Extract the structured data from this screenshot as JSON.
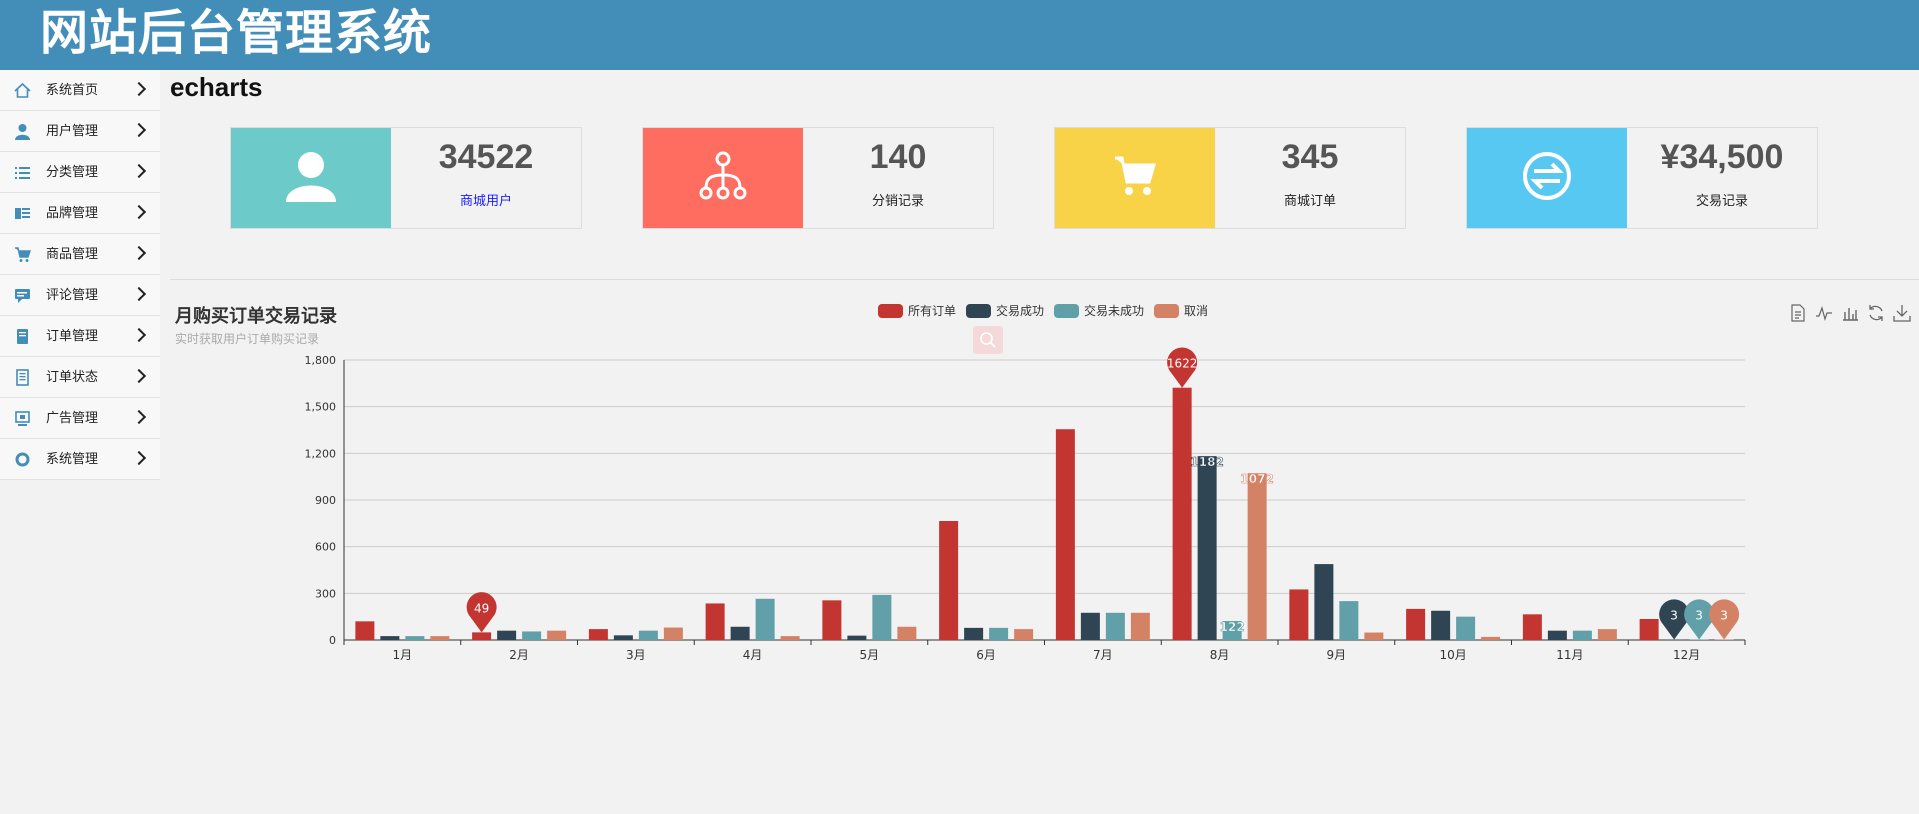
{
  "header": {
    "title": "网站后台管理系统"
  },
  "sidebar": {
    "items": [
      {
        "label": "系统首页",
        "icon": "home-icon"
      },
      {
        "label": "用户管理",
        "icon": "user-icon"
      },
      {
        "label": "分类管理",
        "icon": "list-icon"
      },
      {
        "label": "品牌管理",
        "icon": "brand-icon"
      },
      {
        "label": "商品管理",
        "icon": "cart-icon"
      },
      {
        "label": "评论管理",
        "icon": "comment-icon"
      },
      {
        "label": "订单管理",
        "icon": "order-icon"
      },
      {
        "label": "订单状态",
        "icon": "document-icon"
      },
      {
        "label": "广告管理",
        "icon": "ad-icon"
      },
      {
        "label": "系统管理",
        "icon": "gear-icon"
      }
    ]
  },
  "page": {
    "title": "echarts"
  },
  "cards": [
    {
      "value": "34522",
      "caption": "商城用户",
      "color": "#6ccac9",
      "icon": "user-icon",
      "caption_color": "#1a1aff"
    },
    {
      "value": "140",
      "caption": "分销记录",
      "color": "#ff6c60",
      "icon": "sitemap-icon",
      "caption_color": "#222222"
    },
    {
      "value": "345",
      "caption": "商城订单",
      "color": "#f8d347",
      "icon": "cart-icon",
      "caption_color": "#222222"
    },
    {
      "value": "¥34,500",
      "caption": "交易记录",
      "color": "#57c8f2",
      "icon": "exchange-icon",
      "caption_color": "#222222"
    }
  ],
  "chart": {
    "title": "月购买订单交易记录",
    "subtitle": "实时获取用户订单购买记录"
  },
  "chart_data": {
    "type": "bar",
    "categories": [
      "1月",
      "2月",
      "3月",
      "4月",
      "5月",
      "6月",
      "7月",
      "8月",
      "9月",
      "10月",
      "11月",
      "12月"
    ],
    "ylim": [
      0,
      1800
    ],
    "yticks": [
      "0",
      "300",
      "600",
      "900",
      "1,200",
      "1,500",
      "1,800"
    ],
    "grid": true,
    "legend_position": "top-center",
    "series": [
      {
        "name": "所有订单",
        "color": "#c23531",
        "values": [
          120,
          49,
          70,
          235,
          255,
          765,
          1355,
          1622,
          325,
          200,
          165,
          135
        ]
      },
      {
        "name": "交易成功",
        "color": "#2f4554",
        "values": [
          25,
          60,
          30,
          85,
          28,
          78,
          175,
          1182,
          488,
          188,
          60,
          3
        ]
      },
      {
        "name": "交易未成功",
        "color": "#61a0a8",
        "values": [
          25,
          55,
          60,
          265,
          290,
          78,
          175,
          122,
          250,
          150,
          60,
          3
        ]
      },
      {
        "name": "取消",
        "color": "#d48265",
        "values": [
          25,
          60,
          80,
          25,
          85,
          70,
          175,
          1072,
          48,
          20,
          70,
          3
        ]
      }
    ],
    "mark_points": [
      {
        "series": "所有订单",
        "category": "2月",
        "label": "49"
      },
      {
        "series": "所有订单",
        "category": "8月",
        "label": "1622"
      },
      {
        "series": "交易成功",
        "category": "12月",
        "label": "3"
      },
      {
        "series": "交易未成功",
        "category": "12月",
        "label": "3"
      },
      {
        "series": "取消",
        "category": "12月",
        "label": "3"
      }
    ],
    "value_labels": [
      {
        "series": "交易成功",
        "category": "8月",
        "label": "1182"
      },
      {
        "series": "交易未成功",
        "category": "8月",
        "label": "122"
      },
      {
        "series": "取消",
        "category": "8月",
        "label": "1072"
      }
    ]
  },
  "toolbox": [
    "data-view-icon",
    "line-chart-icon",
    "bar-chart-icon",
    "restore-icon",
    "save-image-icon"
  ]
}
